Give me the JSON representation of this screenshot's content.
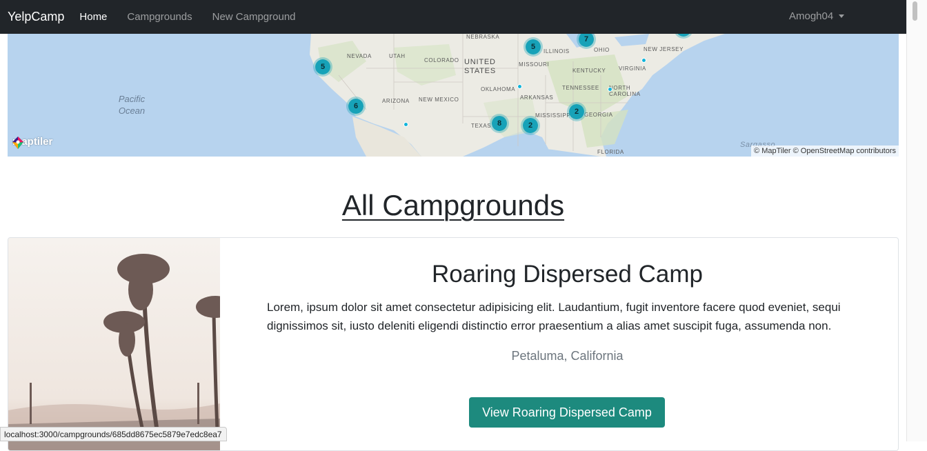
{
  "navbar": {
    "brand": "YelpCamp",
    "links": [
      "Home",
      "Campgrounds",
      "New Campground"
    ],
    "user": "Amogh04"
  },
  "map": {
    "labels": {
      "nebraska": "NEBRASKA",
      "nevada": "NEVADA",
      "utah": "UTAH",
      "colorado": "COLORADO",
      "united_states": "UNITED STATES",
      "illinois": "ILLINOIS",
      "ohio": "OHIO",
      "new_jersey": "NEW JERSEY",
      "missouri": "MISSOURI",
      "kentucky": "KENTUCKY",
      "virginia": "VIRGINIA",
      "oklahoma": "OKLAHOMA",
      "tennessee": "TENNESSEE",
      "north_carolina": "NORTH CAROLINA",
      "arizona": "ARIZONA",
      "new_mexico": "NEW MEXICO",
      "arkansas": "ARKANSAS",
      "texas": "TEXAS",
      "mississippi": "MISSISSIPPI",
      "georgia": "GEORGIA",
      "florida": "FLORIDA",
      "sargasso": "Sargasso",
      "pacific_ocean": "Pacific Ocean"
    },
    "clusters": [
      "5",
      "7",
      "5",
      "6",
      "2",
      "8",
      "2"
    ],
    "logo_text": "maptiler",
    "attribution": "© MapTiler © OpenStreetMap contributors"
  },
  "page": {
    "title": "All Campgrounds"
  },
  "card": {
    "title": "Roaring Dispersed Camp",
    "description": "Lorem, ipsum dolor sit amet consectetur adipisicing elit. Laudantium, fugit inventore facere quod eveniet, sequi dignissimos sit, iusto deleniti eligendi distinctio error praesentium a alias amet suscipit fuga, assumenda non.",
    "location": "Petaluma, California",
    "button": "View Roaring Dispersed Camp"
  },
  "status_bar": {
    "url": "localhost:3000/campgrounds/685dd8675ec5879e7edc8ea7"
  },
  "colors": {
    "navbar": "#212529",
    "cluster": "#17a2b8",
    "button": "#1d8a7e",
    "muted": "#6c757d"
  }
}
